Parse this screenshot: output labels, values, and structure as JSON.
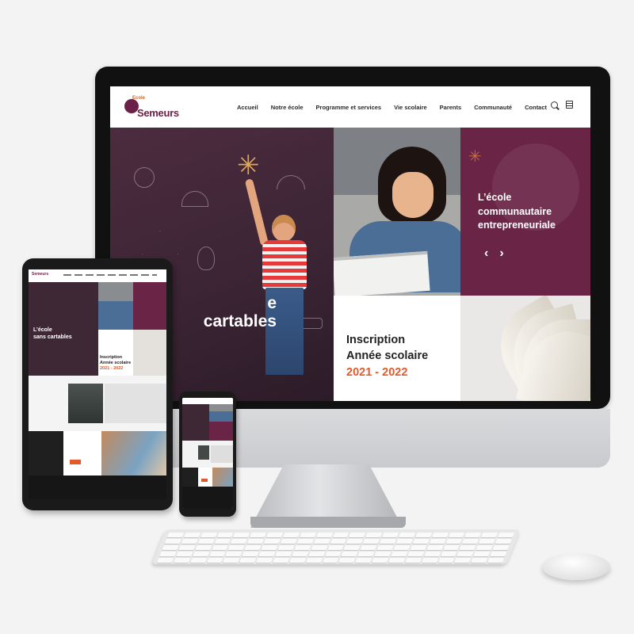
{
  "desktop": {
    "logo": {
      "small_text": "Ecole",
      "name": "Semeurs"
    },
    "nav": [
      "Accueil",
      "Notre école",
      "Programme et services",
      "Vie scolaire",
      "Parents",
      "Communauté",
      "Contact"
    ],
    "hero": {
      "headline_line1": "e",
      "headline_line2": "cartables",
      "slide_text_line1": "L’école",
      "slide_text_line2": "communautaire",
      "slide_text_line3": "entrepreneuriale",
      "prev_arrow": "‹",
      "next_arrow": "›"
    },
    "inscription": {
      "line1": "Inscription",
      "line2": "Année scolaire",
      "line3": "2021 - 2022"
    }
  },
  "tablet": {
    "hero_line1": "L’école",
    "hero_line2": "sans cartables",
    "insc_line1": "Inscription",
    "insc_line2": "Année scolaire",
    "insc_line3": "2021 - 2022"
  },
  "colors": {
    "brand_purple": "#6a2446",
    "accent_orange": "#e05a2b",
    "dark_board": "#3a2433"
  },
  "icons": [
    "search-icon",
    "menu-icon",
    "star-icon"
  ]
}
